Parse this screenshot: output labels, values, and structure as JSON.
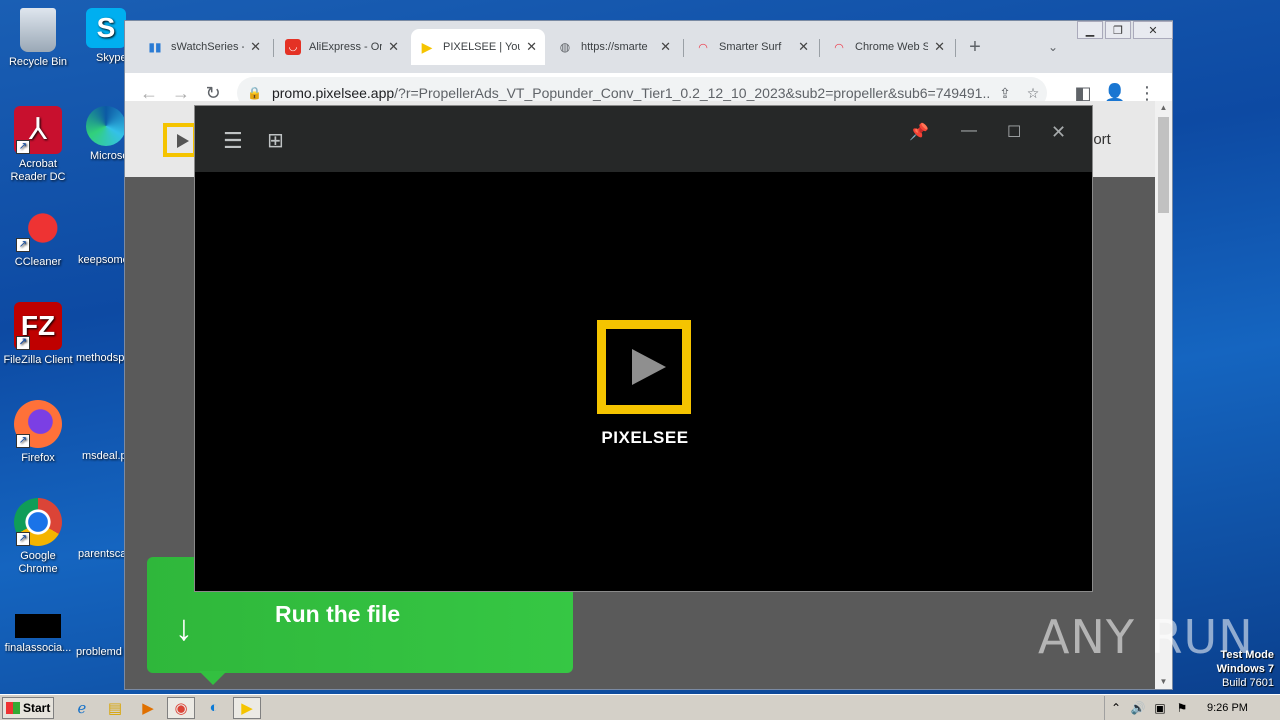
{
  "desktop": {
    "icons": [
      {
        "label": "Recycle Bin",
        "icon": "recycle-bin-icon"
      },
      {
        "label": "Acrobat Reader DC",
        "icon": "acrobat-icon"
      },
      {
        "label": "CCleaner",
        "icon": "ccleaner-icon"
      },
      {
        "label": "FileZilla Client",
        "icon": "filezilla-icon"
      },
      {
        "label": "Firefox",
        "icon": "firefox-icon"
      },
      {
        "label": "Google Chrome",
        "icon": "chrome-icon"
      },
      {
        "label": "finalassocia...",
        "icon": "file-icon"
      }
    ],
    "icons2": [
      {
        "label": "Skype"
      },
      {
        "label": "Microsoft"
      },
      {
        "label": "keepsome"
      },
      {
        "label": "methodsp"
      },
      {
        "label": "msdeal.p"
      },
      {
        "label": "parentsca"
      },
      {
        "label": "problemd"
      }
    ]
  },
  "browser": {
    "tabs": [
      {
        "label": "sWatchSeries -",
        "icon": "swatch-icon"
      },
      {
        "label": "AliExpress - Or",
        "icon": "aliexpress-icon"
      },
      {
        "label": "PIXELSEE | You",
        "icon": "pixelsee-icon"
      },
      {
        "label": "https://smarte",
        "icon": "globe-icon"
      },
      {
        "label": "Smarter Surf",
        "icon": "rainbow-icon"
      },
      {
        "label": "Chrome Web S",
        "icon": "rainbow-icon"
      }
    ],
    "url_host": "promo.pixelsee.app",
    "url_path": "/?r=PropellerAds_VT_Popunder_Conv_Tier1_0.2_12_10_2023&sub2=propeller&sub6=749491..."
  },
  "page": {
    "support_text": "port",
    "run_label": "Run the file"
  },
  "app": {
    "name": "PIXELSEE"
  },
  "watermark": "ANY RUN",
  "test_mode": {
    "line1": "Test Mode",
    "line2": "Windows 7",
    "line3": "Build 7601"
  },
  "taskbar": {
    "start": "Start",
    "clock": "9:26 PM"
  },
  "colors": {
    "accent_yellow": "#f5c400",
    "run_green": "#33c040"
  }
}
